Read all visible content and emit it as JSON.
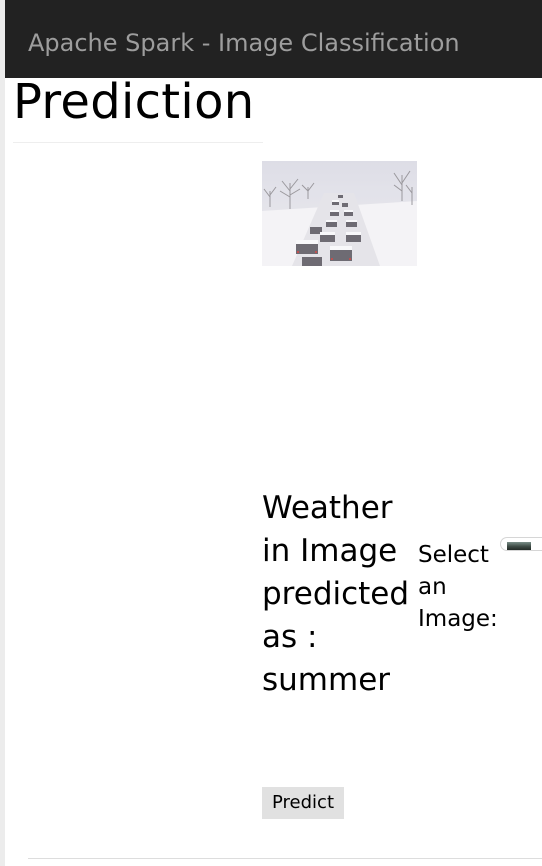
{
  "navbar": {
    "brand": "Apache Spark - Image Classification"
  },
  "page": {
    "title": "Prediction"
  },
  "preview": {
    "image_alt": "Snowy highway with cars"
  },
  "result": {
    "text": "Weather in Image predicted as : summer"
  },
  "upload": {
    "label": "Select an Image:"
  },
  "actions": {
    "predict_label": "Predict"
  }
}
